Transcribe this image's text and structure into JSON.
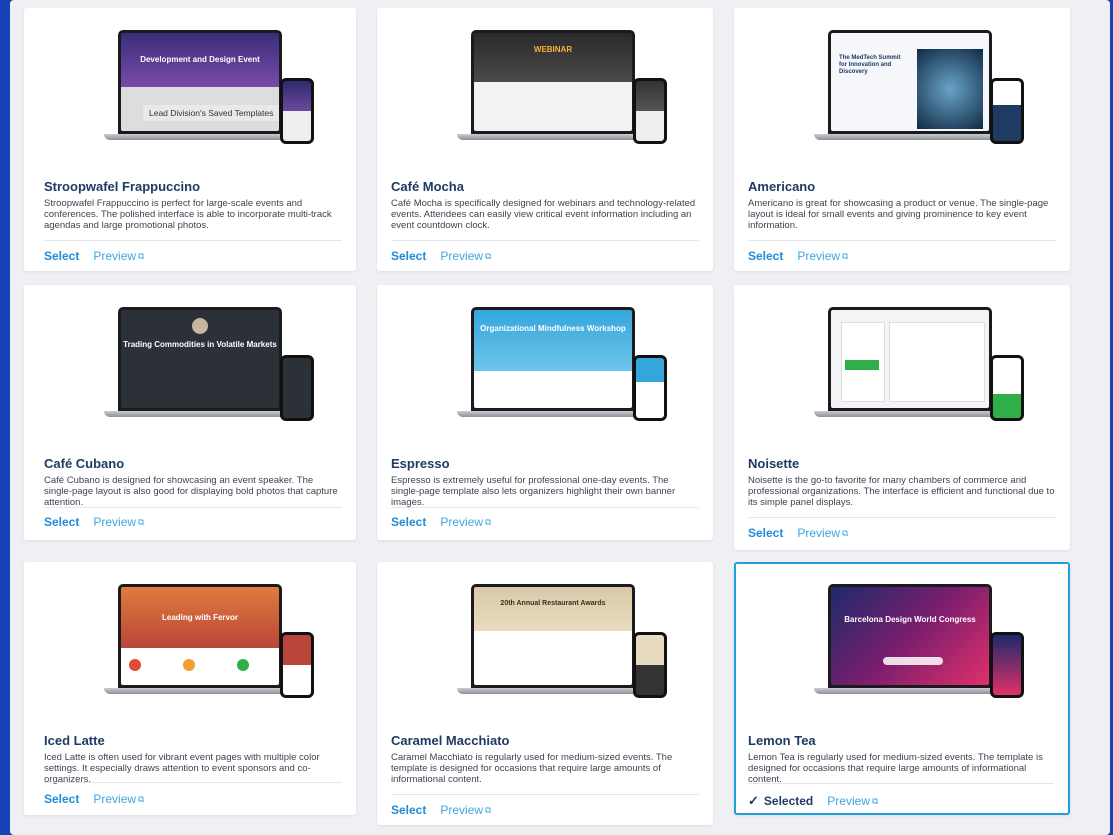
{
  "templates": [
    {
      "name": "Stroopwafel Frappuccino",
      "description": "Stroopwafel Frappuccino is perfect for large-scale events and conferences. The polished interface is able to incorporate multi-track agendas and large promotional photos.",
      "select_label": "Select",
      "preview_label": "Preview",
      "screen_text": "Development and Design Event",
      "overlay_text": "Lead Division's Saved Templates",
      "selected": false
    },
    {
      "name": "Café Mocha",
      "description": "Café Mocha is specifically designed for webinars and technology-related events. Attendees can easily view critical event information including an event countdown clock.",
      "select_label": "Select",
      "preview_label": "Preview",
      "screen_text": "WEBINAR",
      "selected": false
    },
    {
      "name": "Americano",
      "description": "Americano is great for showcasing a product or venue. The single-page layout is ideal for small events and giving prominence to key event information.",
      "select_label": "Select",
      "preview_label": "Preview",
      "screen_text": "The MedTech Summit for Innovation and Discovery",
      "selected": false
    },
    {
      "name": "Café Cubano",
      "description": "Café Cubano is designed for showcasing an event speaker. The single-page layout is also good for displaying bold photos that capture attention.",
      "select_label": "Select",
      "preview_label": "Preview",
      "screen_text": "Trading Commodities in Volatile Markets",
      "selected": false
    },
    {
      "name": "Espresso",
      "description": "Espresso is extremely useful for professional one-day events. The single-page template also lets organizers highlight their own banner images.",
      "select_label": "Select",
      "preview_label": "Preview",
      "screen_text": "Organizational Mindfulness Workshop",
      "selected": false
    },
    {
      "name": "Noisette",
      "description": "Noisette is the go-to favorite for many chambers of commerce and professional organizations. The interface is efficient and functional due to its simple panel displays.",
      "select_label": "Select",
      "preview_label": "Preview",
      "screen_text": "",
      "selected": false
    },
    {
      "name": "Iced Latte",
      "description": "Iced Latte is often used for vibrant event pages with multiple color settings. It especially draws attention to event sponsors and co-organizers.",
      "select_label": "Select",
      "preview_label": "Preview",
      "screen_text": "Leading with Fervor",
      "selected": false
    },
    {
      "name": "Caramel Macchiato",
      "description": "Caramel Macchiato is regularly used for medium-sized events. The template is designed for occasions that require large amounts of informational content.",
      "select_label": "Select",
      "preview_label": "Preview",
      "screen_text": "20th Annual Restaurant Awards",
      "selected": false
    },
    {
      "name": "Lemon Tea",
      "description": "Lemon Tea is regularly used for medium-sized events. The template is designed for occasions that require large amounts of informational content.",
      "select_label": "Selected",
      "preview_label": "Preview",
      "screen_text": "Barcelona Design World Congress",
      "selected": true
    }
  ],
  "icons": {
    "check": "check-icon",
    "external": "external-link-icon"
  },
  "colors": {
    "background": "#1743b8",
    "panel": "#eef0f3",
    "accent": "#1f8dd6",
    "title": "#1f3a63",
    "selected_border": "#1f9fde"
  }
}
